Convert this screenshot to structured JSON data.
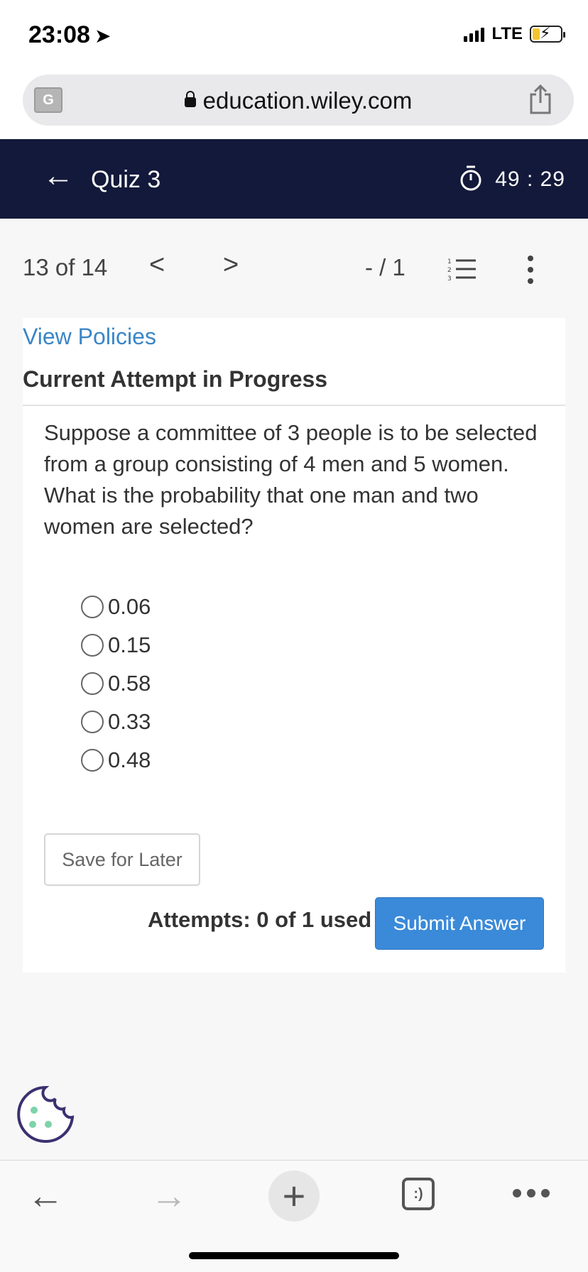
{
  "status_bar": {
    "time": "23:08",
    "network": "LTE"
  },
  "browser": {
    "url": "education.wiley.com"
  },
  "header": {
    "title": "Quiz 3",
    "timer": "49 : 29"
  },
  "question_nav": {
    "position": "13 of 14",
    "score": "- / 1",
    "list_icon_label": "1 2 3"
  },
  "content": {
    "view_policies": "View Policies",
    "attempt_heading": "Current Attempt in Progress",
    "question_text": "Suppose a committee of 3 people is to be selected from a group consisting of 4 men and 5 women. What is the probability that one man and two women are selected?",
    "options": [
      "0.06",
      "0.15",
      "0.58",
      "0.33",
      "0.48"
    ],
    "save_label": "Save for Later",
    "attempts_text": "Attempts: 0 of 1 used",
    "submit_label": "Submit Answer"
  },
  "toolbar": {
    "tabs_label": ":)"
  },
  "colors": {
    "header_bg": "#13193a",
    "link": "#3a86c8",
    "submit_bg": "#3a8ad9",
    "cookie_stroke": "#3b3070",
    "cookie_dots": "#7ed3a8"
  }
}
